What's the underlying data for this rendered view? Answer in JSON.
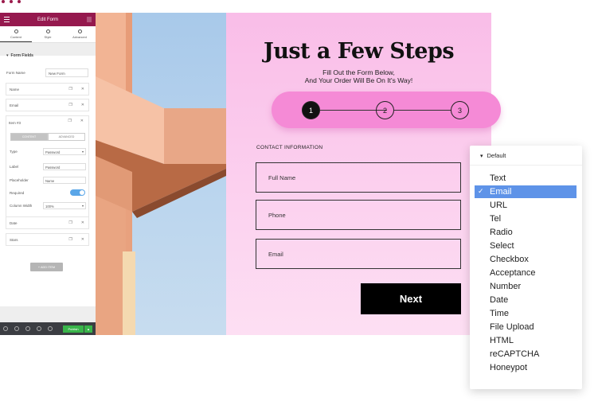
{
  "panel": {
    "title": "Edit Form",
    "tabs": [
      {
        "label": "Content"
      },
      {
        "label": "Style"
      },
      {
        "label": "Advanced"
      }
    ],
    "section_title": "Form Fields",
    "form_name_label": "Form Name",
    "form_name_value": "New Form",
    "fields": [
      {
        "label": "Name"
      },
      {
        "label": "Email"
      }
    ],
    "item3": {
      "title": "Item #3",
      "seg_content": "CONTENT",
      "seg_advanced": "ADVANCED",
      "rows": [
        {
          "label": "Type",
          "value": "Password"
        },
        {
          "label": "Label",
          "value": "Password"
        },
        {
          "label": "Placeholder",
          "value": "Name"
        }
      ],
      "required_label": "Required",
      "column_width_label": "Column Width",
      "column_width_value": "100%"
    },
    "extra_fields": [
      {
        "label": "Date"
      },
      {
        "label": "Stars"
      }
    ],
    "add_item_label": "+ ADD ITEM",
    "publish_label": "Publish"
  },
  "form": {
    "title": "Just a Few Steps",
    "subtitle_line1": "Fill Out the Form Below,",
    "subtitle_line2": "And Your Order Will Be On It's Way!",
    "steps": [
      "1",
      "2",
      "3"
    ],
    "contact_label": "CONTACT INFORMATION",
    "fields": [
      {
        "label": "Full Name"
      },
      {
        "label": "Phone"
      },
      {
        "label": "Email"
      }
    ],
    "next_label": "Next"
  },
  "dropdown": {
    "header": "Default",
    "selected": "Email",
    "options": [
      "Text",
      "Email",
      "URL",
      "Tel",
      "Radio",
      "Select",
      "Checkbox",
      "Acceptance",
      "Number",
      "Date",
      "Time",
      "File Upload",
      "HTML",
      "reCAPTCHA",
      "Honeypot"
    ]
  },
  "colors": {
    "panel_header": "#95194e",
    "accent_pink": "#f58ad6",
    "selection_blue": "#5e93e8",
    "publish_green": "#39b54a"
  }
}
